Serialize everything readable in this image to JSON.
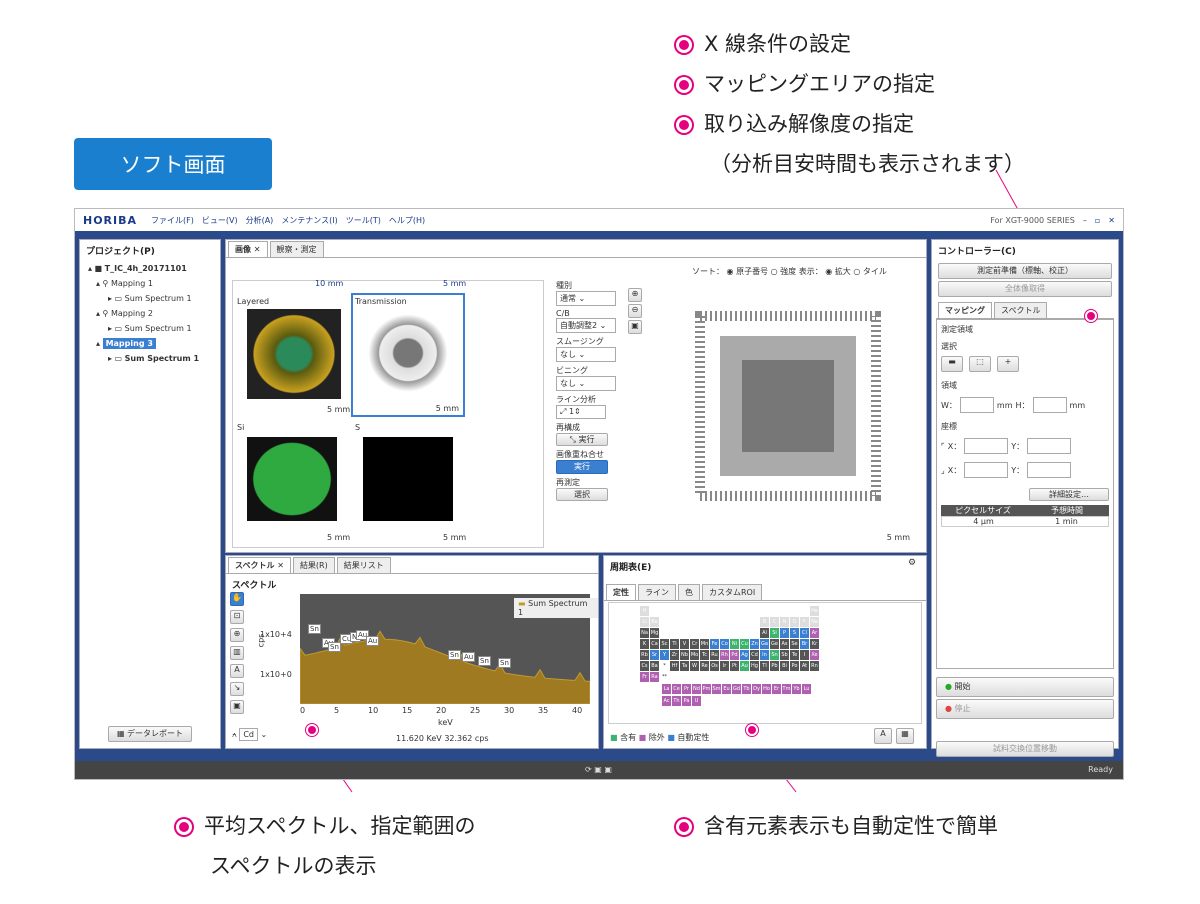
{
  "callouts": {
    "top": [
      "X 線条件の設定",
      "マッピングエリアの指定",
      "取り込み解像度の指定"
    ],
    "top_sub": "（分析目安時間も表示されます）",
    "bottom_left_1": "平均スペクトル、指定範囲の",
    "bottom_left_2": "スペクトルの表示",
    "bottom_right": "含有元素表示も自動定性で簡単"
  },
  "soft_label": "ソフト画面",
  "menubar": {
    "logo": "HORIBA",
    "items": [
      "ファイル(F)",
      "ビュー(V)",
      "分析(A)",
      "メンテナンス(I)",
      "ツール(T)",
      "ヘルプ(H)"
    ],
    "product": "For XGT-9000 SERIES"
  },
  "project": {
    "title": "プロジェクト(P)",
    "items": [
      {
        "label": "T_IC_4h_20171101",
        "bold": true
      },
      {
        "label": "Mapping 1"
      },
      {
        "label": "Sum Spectrum 1"
      },
      {
        "label": "Mapping 2"
      },
      {
        "label": "Sum Spectrum 1"
      },
      {
        "label": "Mapping 3",
        "bold": true
      },
      {
        "label": "Sum Spectrum 1",
        "bold": true
      }
    ],
    "report_button": "データレポート"
  },
  "image_panel": {
    "tabs": [
      "画像 ✕",
      "観察・測定"
    ],
    "sort_label": "ソート：",
    "sort_opts": [
      "原子番号",
      "強度"
    ],
    "display_label": "表示：",
    "display_opts": [
      "拡大",
      "タイル"
    ],
    "tiles": [
      {
        "label": "Layered",
        "scale": "5 mm"
      },
      {
        "label": "Transmission",
        "scale": "5 mm"
      },
      {
        "label": "Si",
        "scale": "5 mm"
      },
      {
        "label": "S",
        "scale": "5 mm"
      }
    ],
    "top_scales": [
      "10 mm",
      "5 mm"
    ],
    "big_scale": "5 mm",
    "controls": {
      "kind": "種別",
      "kind_val": "通常",
      "cb": "C/B",
      "cb_val": "自動調整2",
      "smooth": "スムージング",
      "smooth_val": "なし",
      "bin": "ビニング",
      "bin_val": "なし",
      "line": "ライン分析",
      "line_val": "1",
      "recon": "再構成",
      "exec": "実行",
      "overlay": "画像重ね合せ",
      "overlay_btn": "実行",
      "remeasure": "再測定",
      "select": "選択"
    }
  },
  "spectrum": {
    "tabs": [
      "スペクトル ✕",
      "結果(R)",
      "結果リスト"
    ],
    "title": "スペクトル",
    "legend": "Sum Spectrum 1",
    "ylabel": "cps",
    "yticks": [
      "1x10+4",
      "1x10+0"
    ],
    "xticks": [
      "0",
      "5",
      "10",
      "15",
      "20",
      "25",
      "30",
      "35",
      "40"
    ],
    "xlabel": "keV",
    "readout": "11.620 KeV  32.362 cps",
    "element_sel": "Cd",
    "peaks": [
      "Sn",
      "Au",
      "Sn",
      "Cu",
      "Ni",
      "Au",
      "Au",
      "Sn",
      "Au",
      "Sn",
      "Sn"
    ]
  },
  "periodic": {
    "title": "周期表(E)",
    "tabs": [
      "定性",
      "ライン",
      "色",
      "カスタムROI"
    ],
    "legend": [
      "含有",
      "除外",
      "自動定性"
    ],
    "rows": [
      [
        "H",
        "",
        "",
        "",
        "",
        "",
        "",
        "",
        "",
        "",
        "",
        "",
        "",
        "",
        "",
        "",
        "",
        "He"
      ],
      [
        "Li",
        "Be",
        "",
        "",
        "",
        "",
        "",
        "",
        "",
        "",
        "",
        "",
        "B",
        "C",
        "N",
        "O",
        "F",
        "Ne"
      ],
      [
        "Na",
        "Mg",
        "",
        "",
        "",
        "",
        "",
        "",
        "",
        "",
        "",
        "",
        "Al",
        "Si",
        "P",
        "S",
        "Cl",
        "Ar"
      ],
      [
        "K",
        "Ca",
        "Sc",
        "Ti",
        "V",
        "Cr",
        "Mn",
        "Fe",
        "Co",
        "Ni",
        "Cu",
        "Zn",
        "Ga",
        "Ge",
        "As",
        "Se",
        "Br",
        "Kr"
      ],
      [
        "Rb",
        "Sr",
        "Y",
        "Zr",
        "Nb",
        "Mo",
        "Tc",
        "Ru",
        "Rh",
        "Pd",
        "Ag",
        "Cd",
        "In",
        "Sn",
        "Sb",
        "Te",
        "I",
        "Xe"
      ],
      [
        "Cs",
        "Ba",
        "*",
        "Hf",
        "Ta",
        "W",
        "Re",
        "Os",
        "Ir",
        "Pt",
        "Au",
        "Hg",
        "Tl",
        "Pb",
        "Bi",
        "Po",
        "At",
        "Rn"
      ],
      [
        "Fr",
        "Ra",
        "**",
        "",
        "",
        "",
        "",
        "",
        "",
        "",
        "",
        "",
        "",
        "",
        "",
        "",
        "",
        ""
      ]
    ],
    "lan": [
      "La",
      "Ce",
      "Pr",
      "Nd",
      "Pm",
      "Sm",
      "Eu",
      "Gd",
      "Tb",
      "Dy",
      "Ho",
      "Er",
      "Tm",
      "Yb",
      "Lu"
    ],
    "act": [
      "Ac",
      "Th",
      "Pa",
      "U"
    ]
  },
  "controller": {
    "title": "コントローラー(C)",
    "btn1": "測定前準備（標軸、校正）",
    "btn2": "全体像取得",
    "tabs": [
      "マッピング",
      "スペクトル"
    ],
    "area_title": "測定領域",
    "select": "選択",
    "region": "領域",
    "w": "W：",
    "h": "H：",
    "mm": "mm",
    "coord": "座標",
    "x": "X：",
    "y": "Y：",
    "detail": "詳細設定…",
    "table_head": [
      "ピクセルサイズ",
      "予想時間"
    ],
    "table_row": [
      "4 μm",
      "1 min"
    ],
    "start": "開始",
    "stop": "停止",
    "move": "試料交換位置移動"
  },
  "status": "Ready",
  "colors": {
    "accent": "#1b7fd0",
    "callout": "#e5007f",
    "frame": "#2a4a8a"
  }
}
